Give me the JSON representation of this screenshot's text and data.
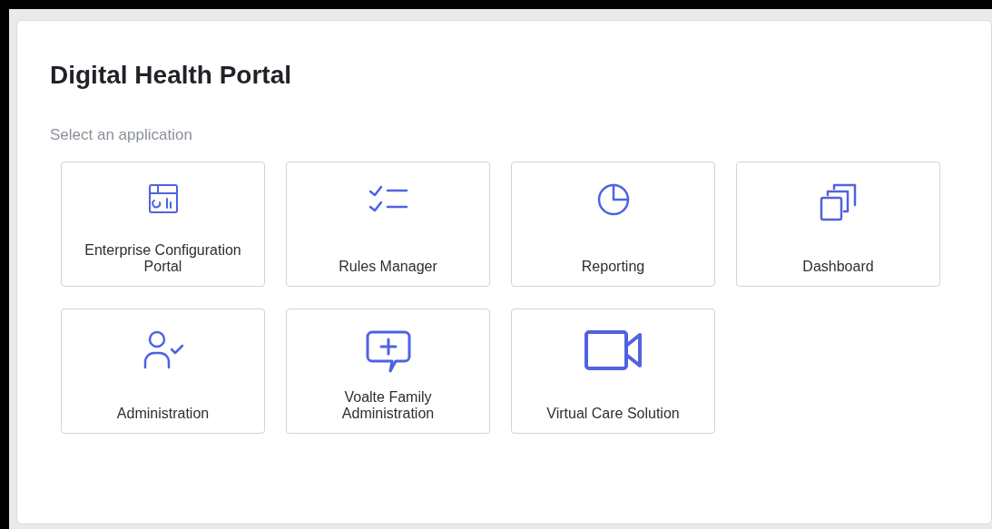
{
  "title": "Digital Health Portal",
  "subtitle": "Select an application",
  "apps": [
    {
      "label": "Enterprise Configuration Portal",
      "kind": "layout"
    },
    {
      "label": "Rules Manager",
      "kind": "checklist"
    },
    {
      "label": "Reporting",
      "kind": "pie"
    },
    {
      "label": "Dashboard",
      "kind": "stack"
    },
    {
      "label": "Administration",
      "kind": "usercheck"
    },
    {
      "label": "Voalte Family Administration",
      "kind": "message"
    },
    {
      "label": "Virtual Care Solution",
      "kind": "video"
    }
  ]
}
